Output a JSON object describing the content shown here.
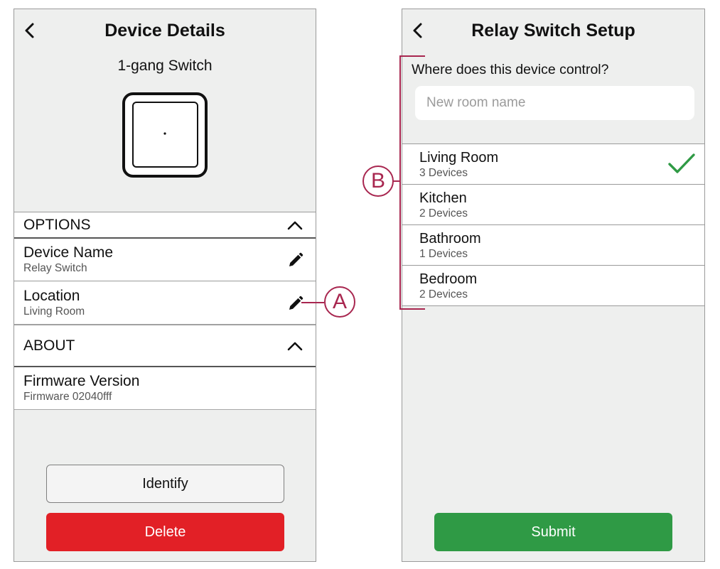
{
  "left_screen": {
    "title": "Device Details",
    "device_type": "1-gang Switch",
    "options": {
      "header": "OPTIONS",
      "items": [
        {
          "label": "Device Name",
          "value": "Relay Switch"
        },
        {
          "label": "Location",
          "value": "Living Room"
        }
      ]
    },
    "about": {
      "header": "ABOUT",
      "items": [
        {
          "label": "Firmware Version",
          "value": "Firmware 02040fff"
        }
      ]
    },
    "identify_label": "Identify",
    "delete_label": "Delete"
  },
  "right_screen": {
    "title": "Relay Switch Setup",
    "question": "Where does this device control?",
    "room_input": {
      "placeholder": "New room name",
      "value": ""
    },
    "rooms": [
      {
        "name": "Living Room",
        "devices": "3 Devices",
        "selected": true
      },
      {
        "name": "Kitchen",
        "devices": "2 Devices",
        "selected": false
      },
      {
        "name": "Bathroom",
        "devices": "1 Devices",
        "selected": false
      },
      {
        "name": "Bedroom",
        "devices": "2 Devices",
        "selected": false
      }
    ],
    "submit_label": "Submit"
  },
  "callouts": {
    "a": "A",
    "b": "B"
  },
  "colors": {
    "screen_bg": "#eeefee",
    "delete": "#e22026",
    "submit": "#2f9a45",
    "check": "#2f9a45",
    "callout": "#a8264f"
  },
  "icons": [
    "back-chevron-icon",
    "chevron-up-icon",
    "pencil-icon",
    "check-icon"
  ]
}
